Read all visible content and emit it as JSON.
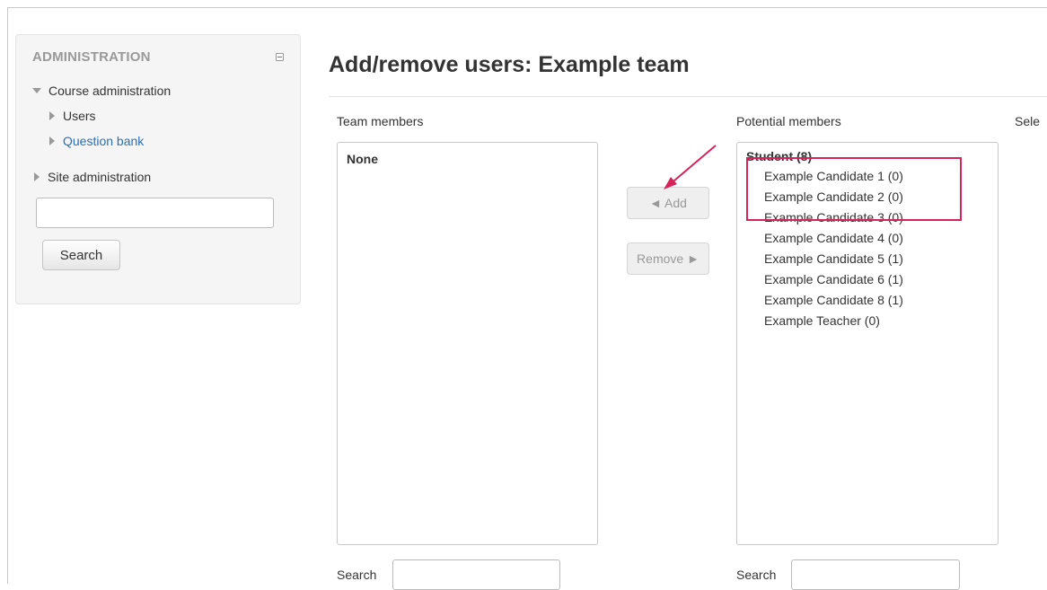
{
  "admin": {
    "title": "ADMINISTRATION",
    "course_admin": "Course administration",
    "users": "Users",
    "question_bank": "Question bank",
    "site_admin": "Site administration",
    "search_value": "",
    "search_button": "Search"
  },
  "page": {
    "title": "Add/remove users: Example team"
  },
  "team": {
    "label": "Team members",
    "empty": "None",
    "search_label": "Search",
    "search_value": ""
  },
  "potential": {
    "label": "Potential members",
    "group": "Student (8)",
    "options": [
      "Example Candidate 1 (0)",
      "Example Candidate 2 (0)",
      "Example Candidate 3 (0)",
      "Example Candidate 4 (0)",
      "Example Candidate 5 (1)",
      "Example Candidate 6 (1)",
      "Example Candidate 8 (1)",
      "Example Teacher (0)"
    ],
    "search_label": "Search",
    "search_value": ""
  },
  "selected_label_partial": "Sele",
  "buttons": {
    "add": "◄ Add",
    "remove": "Remove ►"
  },
  "colors": {
    "highlight": "#d6245a",
    "link": "#2a6fb7"
  }
}
